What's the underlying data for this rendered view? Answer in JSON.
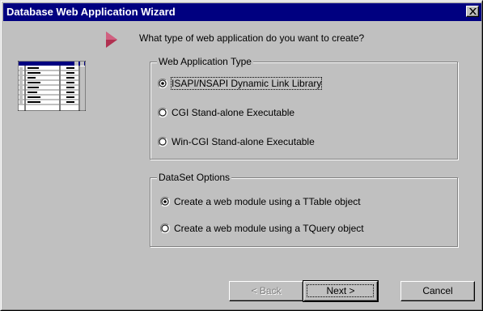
{
  "window": {
    "title": "Database Web Application Wizard"
  },
  "prompt": {
    "question": "What type of web application do you want to create?"
  },
  "app_type_group": {
    "legend": "Web Application Type",
    "options": [
      {
        "label": "ISAPI/NSAPI Dynamic Link Library",
        "selected": true,
        "mnemonic": "I"
      },
      {
        "label": "CGI Stand-alone Executable",
        "selected": false,
        "mnemonic": "C"
      },
      {
        "label": "Win-CGI Stand-alone Executable",
        "selected": false,
        "mnemonic": "W"
      }
    ]
  },
  "dataset_group": {
    "legend": "DataSet Options",
    "options": [
      {
        "label": "Create a web module using a TTable object",
        "selected": true,
        "mnemonic": "T"
      },
      {
        "label": "Create a web module using a TQuery object",
        "selected": false,
        "mnemonic": "Q"
      }
    ]
  },
  "buttons": {
    "back": "< Back",
    "next": "Next >",
    "cancel": "Cancel"
  },
  "icons": {
    "arrow": "arrow-right-icon",
    "grid": "data-grid-icon",
    "close": "close-icon"
  },
  "colors": {
    "titlebar": "#000080",
    "face": "#c0c0c0",
    "arrow": "#c04060"
  }
}
